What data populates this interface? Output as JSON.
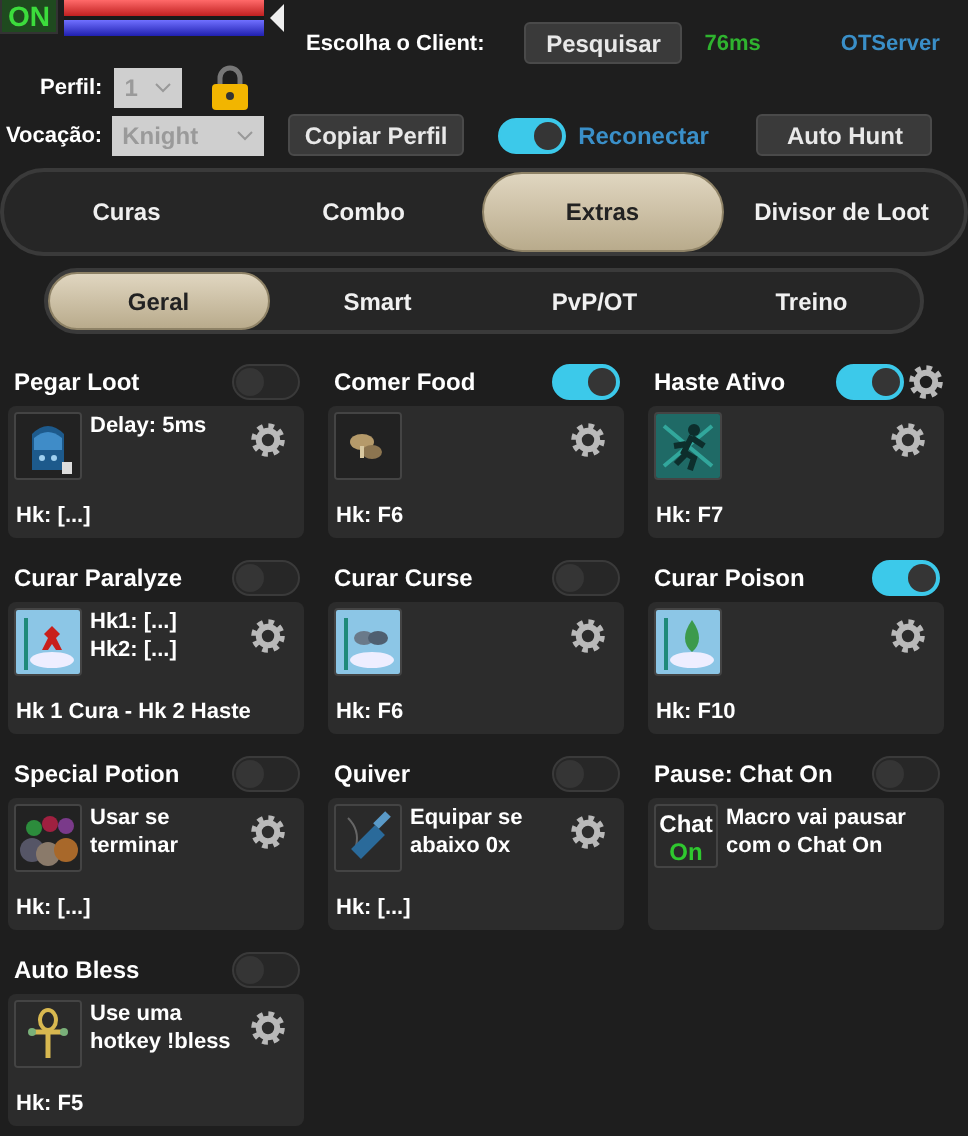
{
  "status": {
    "label": "ON"
  },
  "health_bar": {
    "level": 1
  },
  "mana_bar": {
    "level": 1
  },
  "client": {
    "label": "Escolha o Client:",
    "button": "Pesquisar",
    "ping": "76ms",
    "server": "OTServer"
  },
  "profile": {
    "label": "Perfil:",
    "value": "1",
    "disabled": true
  },
  "vocation": {
    "label": "Vocação:",
    "value": "Knight",
    "disabled": true
  },
  "copy_button": "Copiar Perfil",
  "reconnect": {
    "label": "Reconectar",
    "on": true
  },
  "auto_hunt_button": "Auto Hunt",
  "main_tabs": [
    {
      "label": "Curas",
      "selected": false
    },
    {
      "label": "Combo",
      "selected": false
    },
    {
      "label": "Extras",
      "selected": true
    },
    {
      "label": "Divisor de Loot",
      "selected": false
    }
  ],
  "sub_tabs": [
    {
      "label": "Geral",
      "selected": true
    },
    {
      "label": "Smart",
      "selected": false
    },
    {
      "label": "PvP/OT",
      "selected": false
    },
    {
      "label": "Treino",
      "selected": false
    }
  ],
  "modules": [
    {
      "title": "Pegar Loot",
      "on": false,
      "header_gear": false,
      "info": [
        "Delay: 5ms"
      ],
      "gear": true,
      "hotkey": "Hk: [...]"
    },
    {
      "title": "Comer Food",
      "on": true,
      "header_gear": false,
      "gear": true,
      "hotkey": "Hk: F6"
    },
    {
      "title": "Haste Ativo",
      "on": true,
      "header_gear": true,
      "gear": true,
      "hotkey": "Hk: F7"
    },
    {
      "title": "Curar Paralyze",
      "on": false,
      "header_gear": false,
      "info": [
        "Hk1: [...]",
        "Hk2: [...]"
      ],
      "gear": true,
      "hotkey": "Hk 1 Cura - Hk 2 Haste"
    },
    {
      "title": "Curar Curse",
      "on": false,
      "header_gear": false,
      "gear": true,
      "hotkey": "Hk: F6"
    },
    {
      "title": "Curar Poison",
      "on": true,
      "header_gear": false,
      "gear": true,
      "hotkey": "Hk: F10"
    },
    {
      "title": "Special Potion",
      "on": false,
      "header_gear": false,
      "info": [
        "Usar se terminar"
      ],
      "gear": true,
      "hotkey": "Hk: [...]"
    },
    {
      "title": "Quiver",
      "on": false,
      "header_gear": false,
      "info": [
        "Equipar se abaixo 0x"
      ],
      "gear": true,
      "hotkey": "Hk: [...]"
    },
    {
      "title": "Pause: Chat On",
      "on": false,
      "header_gear": false,
      "badge": {
        "top": "Chat",
        "bottom": "On"
      },
      "info": [
        "Macro vai pausar com o Chat On"
      ],
      "gear": false
    },
    {
      "title": "Auto Bless",
      "on": false,
      "header_gear": false,
      "info": [
        "Use uma hotkey !bless"
      ],
      "gear": true,
      "hotkey": "Hk: F5"
    }
  ]
}
